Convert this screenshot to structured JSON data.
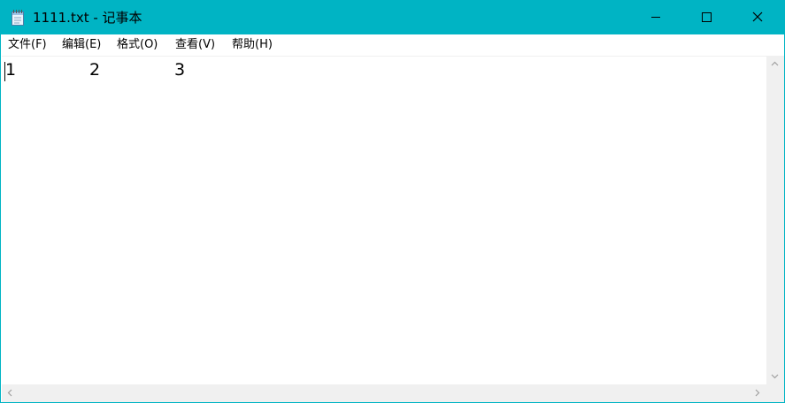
{
  "window": {
    "title": "1111.txt - 记事本",
    "app_icon": "notepad-icon",
    "colors": {
      "titlebar": "#00b4c4",
      "background": "#ffffff",
      "scrollbar": "#f0f0f0"
    }
  },
  "caption_buttons": {
    "minimize_icon": "minimize-icon",
    "maximize_icon": "maximize-icon",
    "close_icon": "close-icon"
  },
  "menubar": {
    "items": [
      {
        "label": "文件(F)"
      },
      {
        "label": "编辑(E)"
      },
      {
        "label": "格式(O)"
      },
      {
        "label": "查看(V)"
      },
      {
        "label": "帮助(H)"
      }
    ]
  },
  "editor": {
    "cells": [
      "1",
      "2",
      "3"
    ]
  },
  "scrollbars": {
    "up_icon": "chevron-up-icon",
    "down_icon": "chevron-down-icon",
    "left_icon": "chevron-left-icon",
    "right_icon": "chevron-right-icon"
  }
}
